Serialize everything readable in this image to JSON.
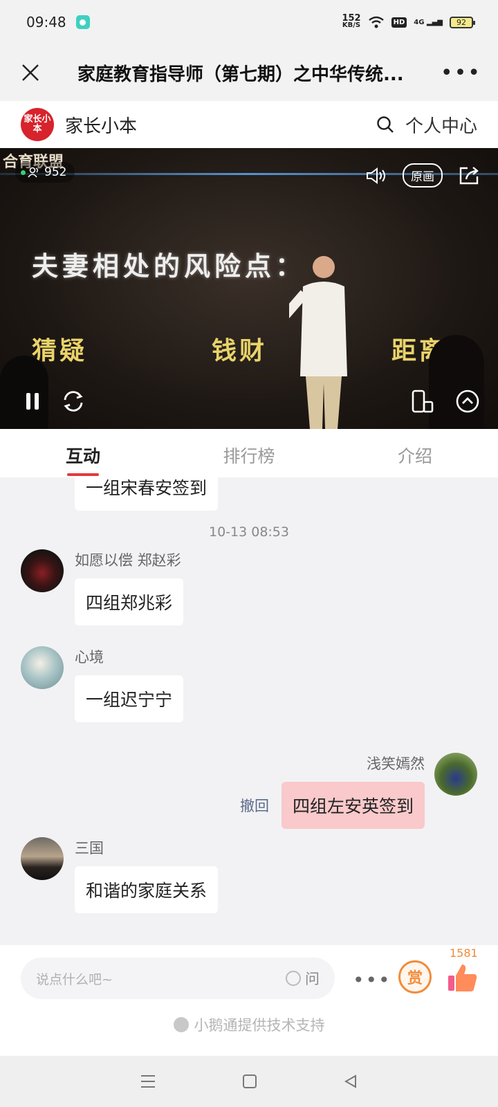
{
  "status_bar": {
    "time": "09:48",
    "net_speed": "152",
    "net_unit": "KB/S",
    "hd": "HD",
    "signal": "4G",
    "battery": "92"
  },
  "nav": {
    "title": "家庭教育指导师（第七期）之中华传统..."
  },
  "shop": {
    "logo_text": "家长小本",
    "name": "家长小本",
    "personal_center": "个人中心"
  },
  "video": {
    "brand_text": "合育联盟",
    "viewers": "952",
    "quality": "原画",
    "slide_title": "夫妻相处的风险点：",
    "slide_items": [
      "猜疑",
      "钱财",
      "距离"
    ]
  },
  "tabs": [
    {
      "label": "互动",
      "active": true
    },
    {
      "label": "排行榜",
      "active": false
    },
    {
      "label": "介绍",
      "active": false
    }
  ],
  "chat": {
    "partial_message": "一组宋春安签到",
    "timestamp": "10-13 08:53",
    "messages": [
      {
        "name": "如愿以偿 郑赵彩",
        "text": "四组郑兆彩"
      },
      {
        "name": "心境",
        "text": "一组迟宁宁"
      },
      {
        "name": "浅笑嫣然",
        "text": "四组左安英签到",
        "mine": true,
        "recall": "撤回"
      },
      {
        "name": "三国",
        "text": "和谐的家庭关系"
      }
    ]
  },
  "input_bar": {
    "placeholder": "说点什么吧~",
    "ask_label": "问",
    "reward_label": "赏",
    "like_count": "1581",
    "powered_by": "小鹅通提供技术支持"
  },
  "colors": {
    "accent": "#e4393c",
    "brand_red": "#d7232b",
    "my_bubble": "#f9c9cb",
    "reward_orange": "#f28c3a"
  },
  "icons": {
    "close": "close-icon",
    "more": "more-icon",
    "search": "search-icon",
    "volume": "volume-icon",
    "share": "share-icon",
    "pause": "pause-icon",
    "refresh": "refresh-icon",
    "rotate": "rotate-screen-icon",
    "collapse": "chevron-up-icon",
    "like": "thumbs-up-icon"
  }
}
